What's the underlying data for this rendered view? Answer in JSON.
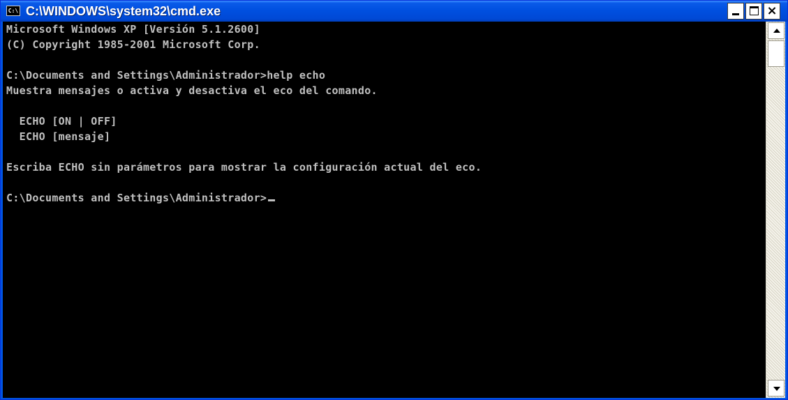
{
  "window": {
    "title": "C:\\WINDOWS\\system32\\cmd.exe",
    "app_icon_label": "C:\\",
    "controls": [
      "minimize",
      "maximize",
      "close"
    ],
    "close_glyph": "×"
  },
  "console": {
    "lines": [
      "Microsoft Windows XP [Versión 5.1.2600]",
      "(C) Copyright 1985-2001 Microsoft Corp.",
      "",
      "C:\\Documents and Settings\\Administrador>help echo",
      "Muestra mensajes o activa y desactiva el eco del comando.",
      "",
      "  ECHO [ON | OFF]",
      "  ECHO [mensaje]",
      "",
      "Escriba ECHO sin parámetros para mostrar la configuración actual del eco.",
      "",
      "C:\\Documents and Settings\\Administrador>"
    ],
    "text_color": "#c0c0c0",
    "background": "#000000"
  },
  "colors": {
    "titlebar": "#0054e3",
    "title_text": "#ffffff",
    "scrollbar_track": "#f2f0e6"
  },
  "icons": {
    "app": "console-app-icon",
    "minimize": "minimize-icon",
    "maximize": "maximize-icon",
    "close": "close-icon",
    "scroll_up": "scroll-up-arrow-icon",
    "scroll_down": "scroll-down-arrow-icon"
  }
}
